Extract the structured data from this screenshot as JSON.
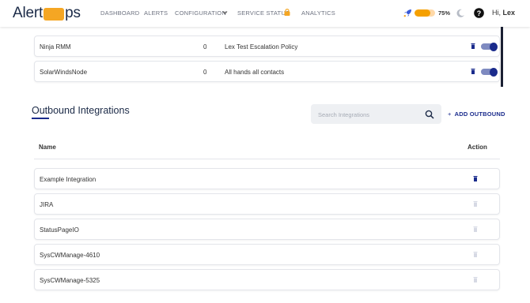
{
  "header": {
    "logo_left": "Alert",
    "logo_right": "ps",
    "nav": [
      {
        "label": "DASHBOARD"
      },
      {
        "label": "ALERTS"
      },
      {
        "label": "CONFIGURATION"
      },
      {
        "label": "SERVICE STATUS"
      },
      {
        "label": "ANALYTICS"
      }
    ],
    "progress_percent": 75,
    "progress_label": "75%",
    "greeting": "Hi,",
    "user_name": "Lex"
  },
  "inbound_rows": [
    {
      "name": "Ninja RMM",
      "count": "0",
      "policy": "Lex Test Escalation Policy",
      "enabled": true
    },
    {
      "name": "SolarWindsNode",
      "count": "0",
      "policy": "All hands all contacts",
      "enabled": true
    }
  ],
  "outbound": {
    "title": "Outbound Integrations",
    "search_placeholder": "Search Integrations",
    "add_label": "ADD OUTBOUND",
    "columns": {
      "name": "Name",
      "action": "Action"
    },
    "rows": [
      {
        "name": "Example Integration",
        "action_active": true
      },
      {
        "name": "JIRA",
        "action_active": false
      },
      {
        "name": "StatusPageIO",
        "action_active": false
      },
      {
        "name": "SysCWManage-4610",
        "action_active": false
      },
      {
        "name": "SysCWManage-5325",
        "action_active": false
      }
    ]
  },
  "colors": {
    "brand_navy": "#1a2b8c",
    "brand_orange": "#f5a623",
    "muted_icon": "#d6d9e4"
  }
}
